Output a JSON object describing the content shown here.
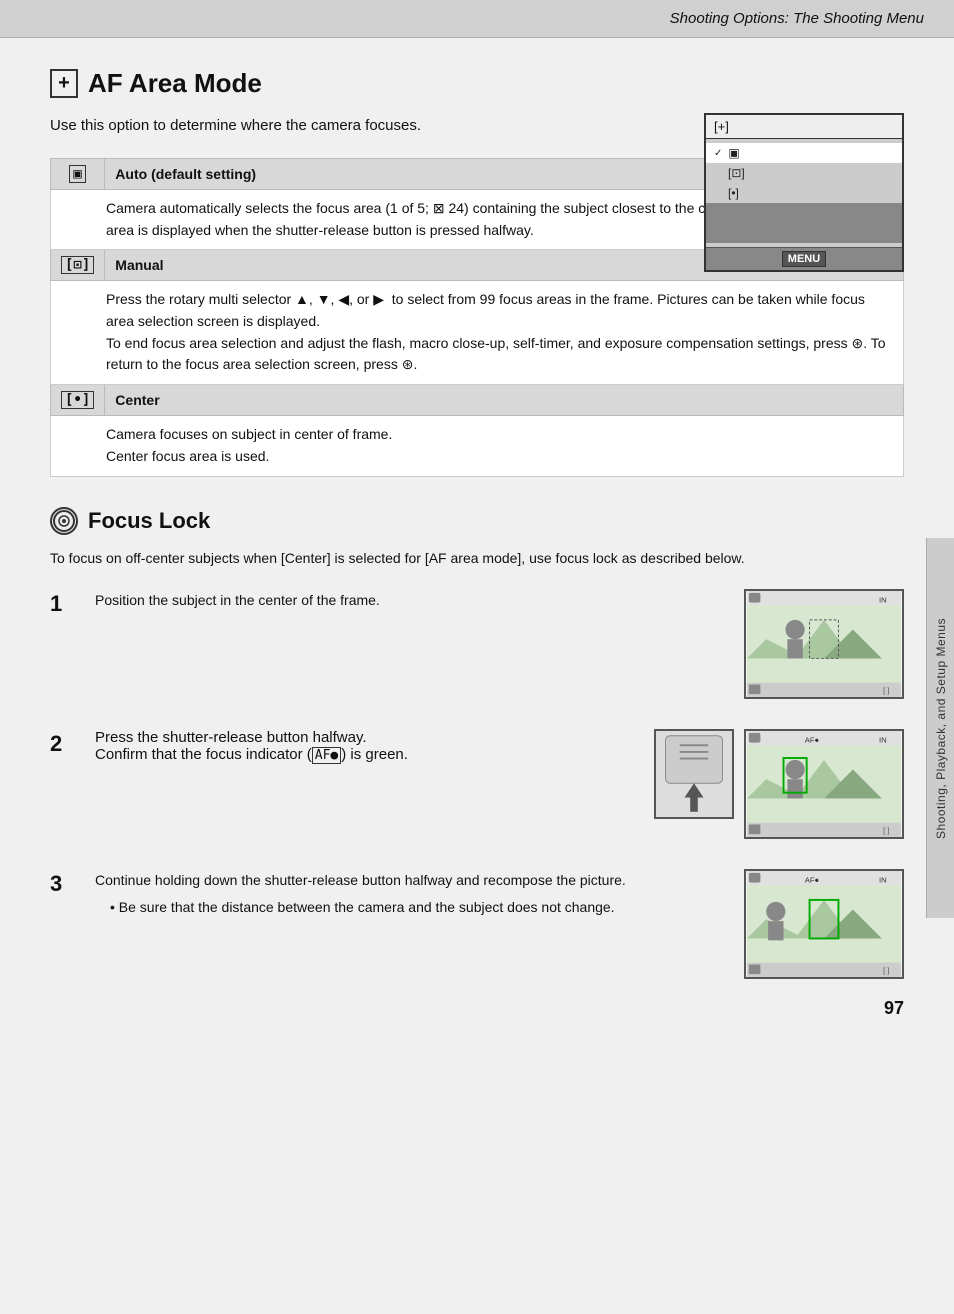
{
  "header": {
    "title": "Shooting Options: The Shooting Menu"
  },
  "af_area_mode": {
    "title": "AF Area Mode",
    "icon": "[+]",
    "intro": "Use this option to determine where the camera focuses.",
    "camera_menu": {
      "header_icon": "[+]",
      "items": [
        {
          "label": "▣",
          "selected": true
        },
        {
          "label": "[⊡]"
        },
        {
          "label": "[•]"
        }
      ],
      "footer": "MENU"
    },
    "options": [
      {
        "icon": "▣",
        "label": "Auto (default setting)",
        "description": "Camera automatically selects the focus area (1 of 5; ⊠ 24) containing the subject closest to the camera. The selected focus area is displayed when the shutter-release button is pressed halfway."
      },
      {
        "icon": "[⊡]",
        "label": "Manual",
        "description": "Press the rotary multi selector ▲, ▼, ◀, or ▶  to select from 99 focus areas in the frame. Pictures can be taken while focus area selection screen is displayed.\nTo end focus area selection and adjust the flash, macro close-up, self-timer, and exposure compensation settings, press ⊛. To return to the focus area selection screen, press ⊛."
      },
      {
        "icon": "[•]",
        "label": "Center",
        "description": "Camera focuses on subject in center of frame.\nCenter focus area is used."
      }
    ]
  },
  "focus_lock": {
    "title": "Focus Lock",
    "intro": "To focus on off-center subjects when [Center] is selected for [AF area mode], use focus lock as described below.",
    "steps": [
      {
        "number": "1",
        "main_text": "Position the subject in the center of the frame."
      },
      {
        "number": "2",
        "main_text": "Press the shutter-release button halfway.",
        "bullet": "Confirm that the focus indicator (AF●) is green."
      },
      {
        "number": "3",
        "main_text": "Continue holding down the shutter-release button halfway and recompose the picture.",
        "bullet": "Be sure that the distance between the camera and the subject does not change."
      }
    ]
  },
  "side_tab": {
    "text": "Shooting, Playback, and Setup Menus"
  },
  "page": {
    "number": "97"
  }
}
